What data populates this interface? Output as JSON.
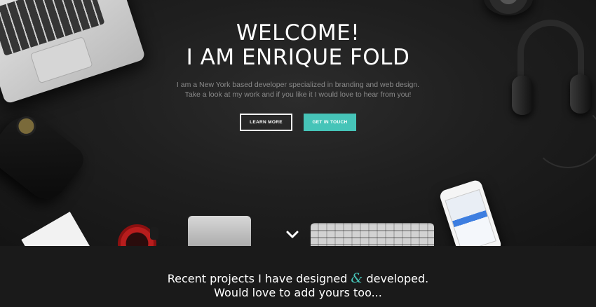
{
  "hero": {
    "title_line1": "WELCOME!",
    "title_line2": "I AM ENRIQUE FOLD",
    "tagline_line1": "I am a New York based developer specialized in branding and web design.",
    "tagline_line2": "Take a look at my work and if you like it I would love to hear from you!",
    "buttons": {
      "learn_more": "LEARN MORE",
      "get_in_touch": "GET IN TOUCH"
    },
    "scroll_icon": "chevron-down-icon"
  },
  "recent": {
    "line1_before": "Recent projects I have designed",
    "ampersand": "&",
    "line1_after": "developed.",
    "line2": "Would love to add yours too..."
  },
  "colors": {
    "accent": "#46c4b8",
    "hero_background": "#1f1f1f",
    "band_background": "#1a1a1a",
    "text": "#ffffff",
    "muted_text": "#8a8a8a"
  }
}
